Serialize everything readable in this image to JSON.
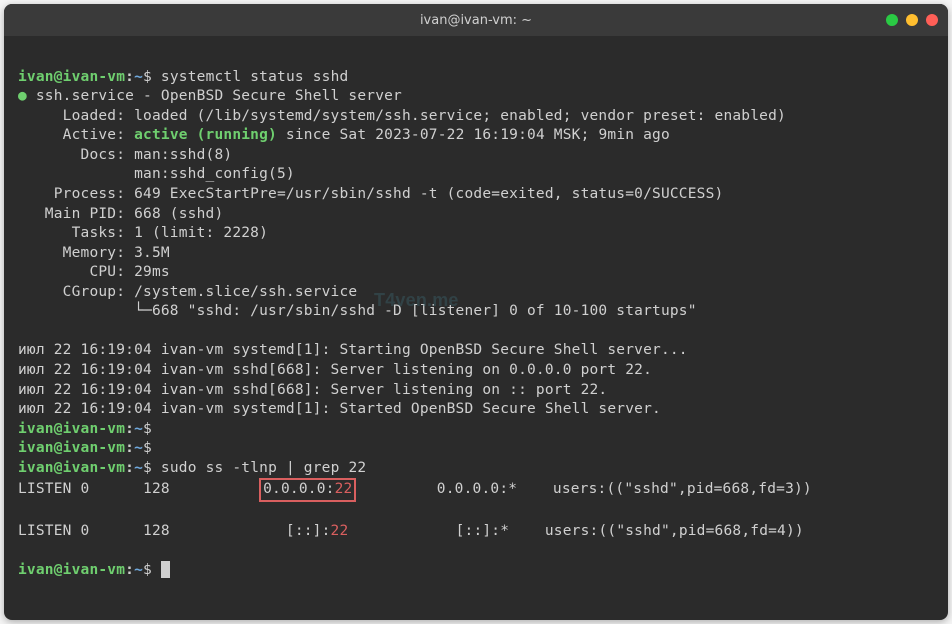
{
  "window": {
    "title": "ivan@ivan-vm: ~"
  },
  "prompt": {
    "userhost": "ivan@ivan-vm",
    "sep": ":",
    "path": "~",
    "symbol": "$"
  },
  "cmd1": "systemctl status sshd",
  "cmd2": "sudo ss -tlnp | grep 22",
  "service": {
    "name_line": " ssh.service - OpenBSD Secure Shell server",
    "loaded": "     Loaded: loaded (/lib/systemd/system/ssh.service; enabled; vendor preset: enabled)",
    "active_label": "     Active: ",
    "active_status": "active (running)",
    "active_since": " since Sat 2023-07-22 16:19:04 MSK; 9min ago",
    "docs1": "       Docs: man:sshd(8)",
    "docs2": "             man:sshd_config(5)",
    "process": "    Process: 649 ExecStartPre=/usr/sbin/sshd -t (code=exited, status=0/SUCCESS)",
    "mainpid": "   Main PID: 668 (sshd)",
    "tasks": "      Tasks: 1 (limit: 2228)",
    "memory": "     Memory: 3.5M",
    "cpu": "        CPU: 29ms",
    "cgroup1": "     CGroup: /system.slice/ssh.service",
    "cgroup2": "             └─668 \"sshd: /usr/sbin/sshd -D [listener] 0 of 10-100 startups\""
  },
  "logs": {
    "l1": "июл 22 16:19:04 ivan-vm systemd[1]: Starting OpenBSD Secure Shell server...",
    "l2": "июл 22 16:19:04 ivan-vm sshd[668]: Server listening on 0.0.0.0 port 22.",
    "l3": "июл 22 16:19:04 ivan-vm sshd[668]: Server listening on :: port 22.",
    "l4": "июл 22 16:19:04 ivan-vm systemd[1]: Started OpenBSD Secure Shell server."
  },
  "ss": {
    "row1_pre": "LISTEN 0      128          ",
    "row1_box_ip": "0.0.0.0:",
    "row1_box_port": "22",
    "row1_post": "         0.0.0.0:*    users:((\"sshd\",pid=668,fd=3))",
    "blank": "",
    "row2_pre": "LISTEN 0      128             [::]:",
    "row2_port": "22",
    "row2_post": "            [::]:*    users:((\"sshd\",pid=668,fd=4))"
  },
  "watermark": "T4ven.me"
}
